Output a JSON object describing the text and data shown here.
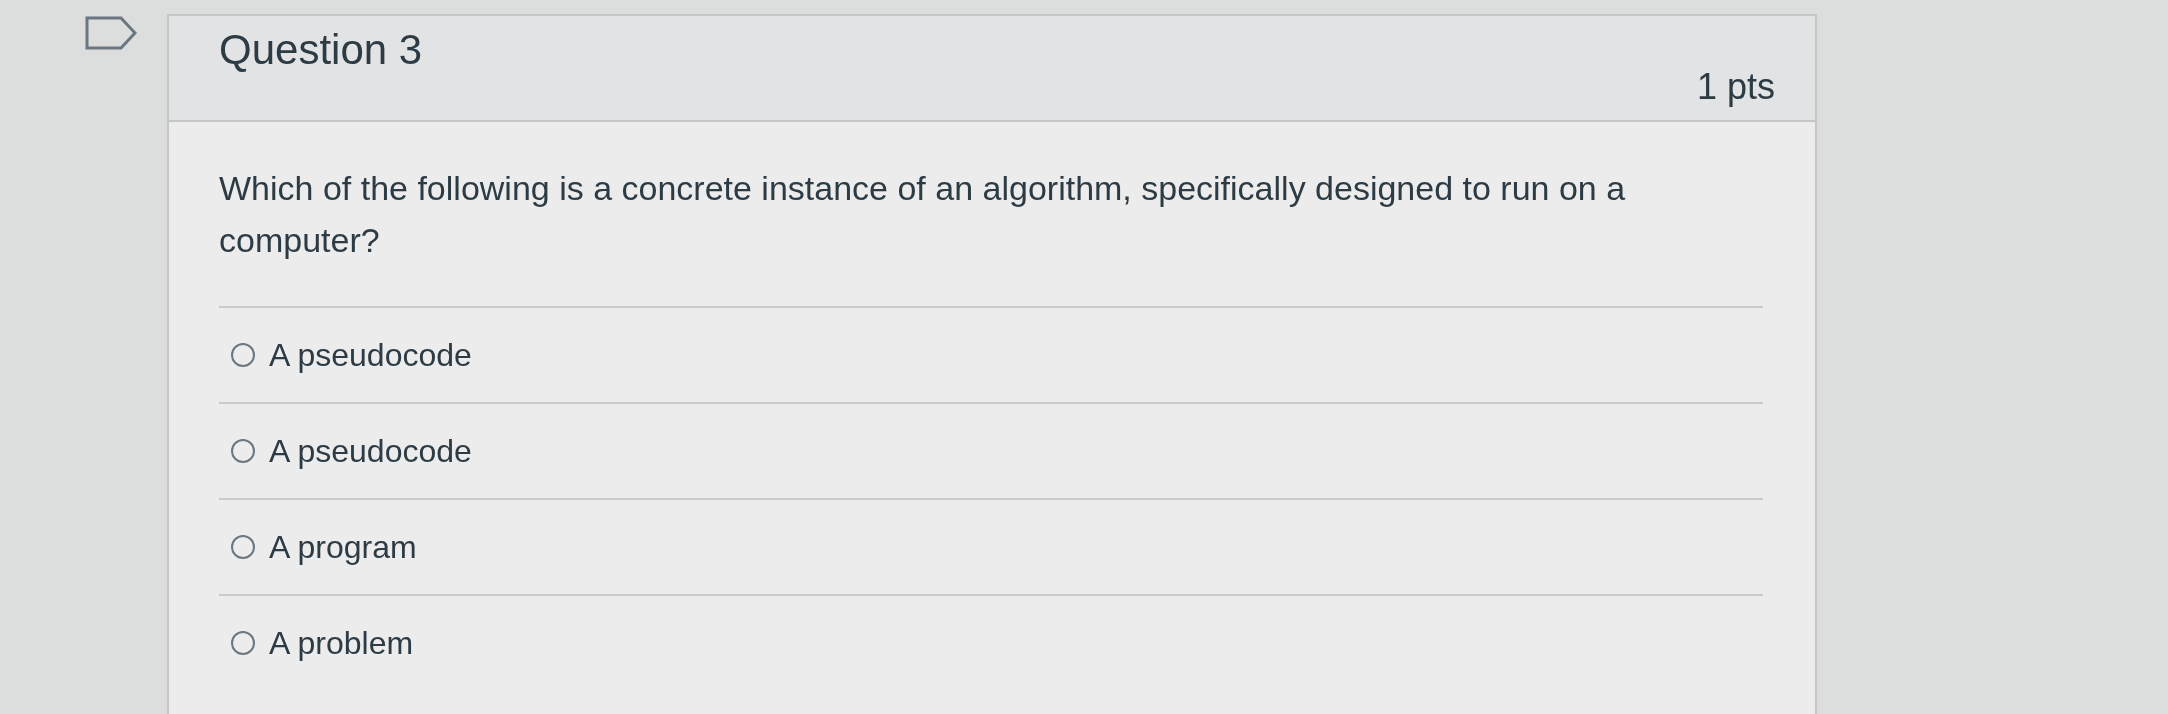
{
  "question": {
    "title": "Question 3",
    "points": "1 pts",
    "text": "Which of the following is a concrete instance of an algorithm, specifically designed to run on a computer?",
    "answers": [
      {
        "label": "A pseudocode",
        "selected": false
      },
      {
        "label": "A pseudocode",
        "selected": false
      },
      {
        "label": "A program",
        "selected": false
      },
      {
        "label": "A problem",
        "selected": false
      }
    ]
  }
}
